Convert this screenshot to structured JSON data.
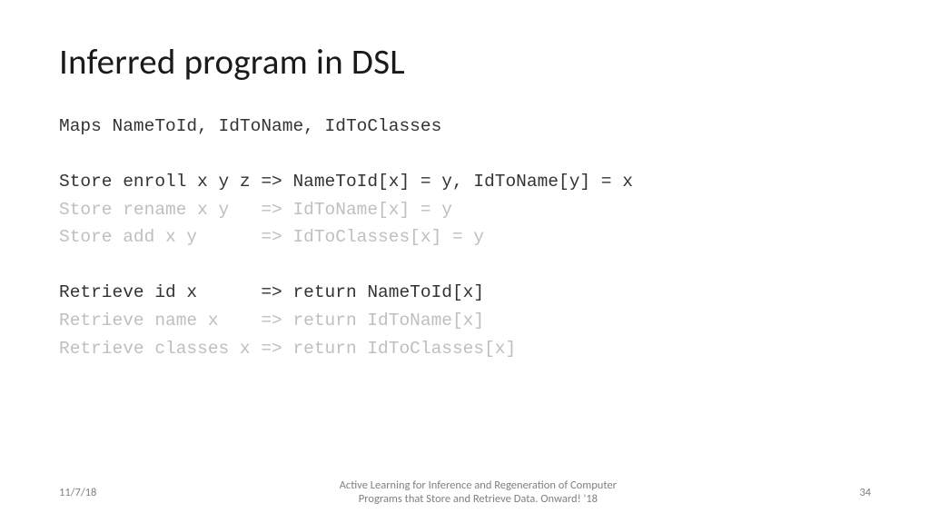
{
  "title": "Inferred program in DSL",
  "code": {
    "maps": "Maps NameToId, IdToName, IdToClasses",
    "store1": "Store enroll x y z => NameToId[x] = y, IdToName[y] = x",
    "store2": "Store rename x y   => IdToName[x] = y",
    "store3": "Store add x y      => IdToClasses[x] = y",
    "retrieve1": "Retrieve id x      => return NameToId[x]",
    "retrieve2": "Retrieve name x    => return IdToName[x]",
    "retrieve3": "Retrieve classes x => return IdToClasses[x]"
  },
  "footer": {
    "date": "11/7/18",
    "center_line1": "Active Learning for Inference and Regeneration of Computer",
    "center_line2": "Programs that Store and Retrieve Data. Onward! '18",
    "page": "34"
  }
}
